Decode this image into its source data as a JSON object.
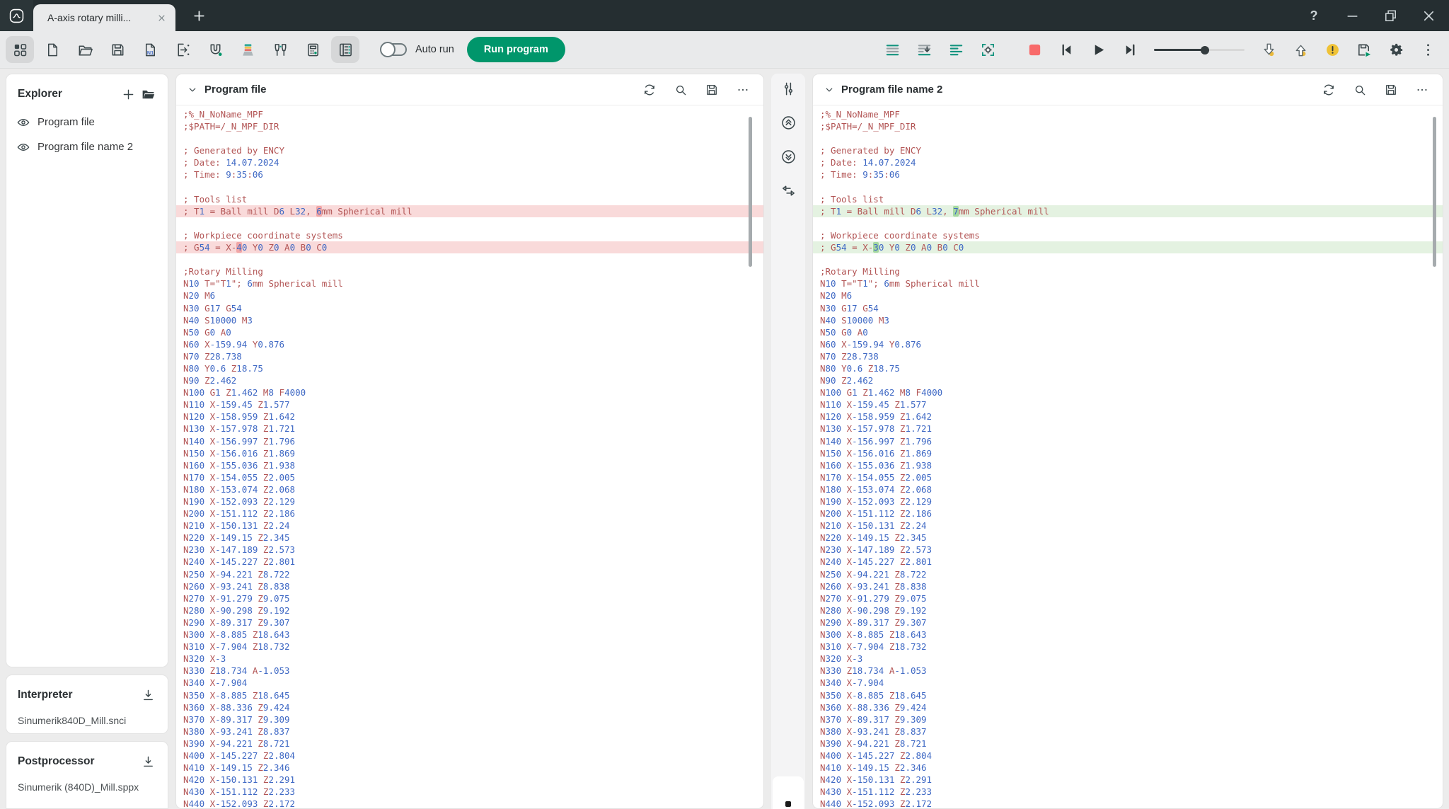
{
  "window": {
    "tab_title": "A-axis rotary milli...",
    "help_label": "?",
    "controls": [
      {
        "name": "help-button",
        "icon": "help"
      },
      {
        "name": "minimize-button",
        "icon": "minimize-icon"
      },
      {
        "name": "maximize-button",
        "icon": "maximize-icon"
      },
      {
        "name": "close-button",
        "icon": "close-icon"
      }
    ]
  },
  "toolbar": {
    "left_icons": [
      {
        "name": "home-grid-icon",
        "active": true
      },
      {
        "name": "new-file-icon"
      },
      {
        "name": "open-folder-icon"
      },
      {
        "name": "save-icon"
      },
      {
        "name": "renumber-icon"
      },
      {
        "name": "insert-file-icon"
      },
      {
        "name": "magnet-icon"
      },
      {
        "name": "layers-icon"
      },
      {
        "name": "tools-icon"
      },
      {
        "name": "calculator-icon"
      },
      {
        "name": "editor-view-icon",
        "active": true
      }
    ],
    "auto_run_label": "Auto run",
    "auto_run_on": false,
    "run_button_label": "Run program",
    "view_icons": [
      {
        "name": "structure-lines-icon"
      },
      {
        "name": "goto-line-icon"
      },
      {
        "name": "format-lines-icon"
      },
      {
        "name": "gear-frame-icon"
      }
    ],
    "playback_icons": [
      {
        "name": "stop-icon"
      },
      {
        "name": "skip-start-icon"
      },
      {
        "name": "play-icon"
      },
      {
        "name": "skip-end-icon"
      }
    ],
    "slider_value_pct": 56,
    "tail_icons": [
      {
        "name": "sim-down-icon"
      },
      {
        "name": "sim-up-icon"
      },
      {
        "name": "warning-icon"
      },
      {
        "name": "post-save-icon"
      },
      {
        "name": "settings-gear-icon"
      },
      {
        "name": "kebab-menu-icon"
      }
    ]
  },
  "explorer": {
    "title": "Explorer",
    "header_icons": [
      {
        "name": "plus-icon"
      },
      {
        "name": "folder-filled-icon"
      }
    ],
    "item_icon": "eye-icon",
    "items": [
      {
        "label": "Program file"
      },
      {
        "label": "Program file name 2"
      }
    ]
  },
  "interpreter": {
    "title": "Interpreter",
    "action_icon": "download-icon",
    "value": "Sinumerik840D_Mill.snci"
  },
  "postprocessor": {
    "title": "Postprocessor",
    "action_icon": "download-icon",
    "value": "Sinumerik (840D)_Mill.sppx"
  },
  "divider": {
    "icons": [
      {
        "name": "tune-icon"
      },
      {
        "name": "collapse-up-icon"
      },
      {
        "name": "collapse-down-icon"
      },
      {
        "name": "swap-icon"
      }
    ]
  },
  "panels_common": {
    "header_icons": [
      {
        "name": "sync-icon"
      },
      {
        "name": "search-icon"
      },
      {
        "name": "save-icon"
      },
      {
        "name": "more-icon"
      }
    ]
  },
  "code_colors": {
    "letters": "#B25454",
    "numbers": "#3E68C4",
    "removed_bg": "#F9DADA",
    "removed_mark": "#F1A6A6",
    "added_bg": "#E4F2E1",
    "added_mark": "#A5D8A0",
    "accent_green": "#00966B",
    "stop_red": "#F86A6A"
  },
  "panels": [
    {
      "title": "Program file",
      "diff_mode": "removed",
      "lines": [
        {
          "t": ";%_N_NoName_MPF"
        },
        {
          "t": ";$PATH=/_N_MPF_DIR"
        },
        {
          "t": ""
        },
        {
          "t": "; Generated by ENCY"
        },
        {
          "t": "; Date: 14.07.2024"
        },
        {
          "t": "; Time: 9:35:06"
        },
        {
          "t": ""
        },
        {
          "t": "; Tools list"
        },
        {
          "t": "; T1 = Ball mill D6 L32, «6»mm Spherical mill",
          "d": true
        },
        {
          "t": ""
        },
        {
          "t": "; Workpiece coordinate systems"
        },
        {
          "t": "; G54 = X-«4»0 Y0 Z0 A0 B0 C0",
          "d": true
        },
        {
          "t": ""
        },
        {
          "t": ";Rotary Milling"
        },
        {
          "t": "N10 T=\"T1\"; 6mm Spherical mill"
        },
        {
          "t": "N20 M6"
        },
        {
          "t": "N30 G17 G54"
        },
        {
          "t": "N40 S10000 M3"
        },
        {
          "t": "N50 G0 A0"
        },
        {
          "t": "N60 X-159.94 Y0.876"
        },
        {
          "t": "N70 Z28.738"
        },
        {
          "t": "N80 Y0.6 Z18.75"
        },
        {
          "t": "N90 Z2.462"
        },
        {
          "t": "N100 G1 Z1.462 M8 F4000"
        },
        {
          "t": "N110 X-159.45 Z1.577"
        },
        {
          "t": "N120 X-158.959 Z1.642"
        },
        {
          "t": "N130 X-157.978 Z1.721"
        },
        {
          "t": "N140 X-156.997 Z1.796"
        },
        {
          "t": "N150 X-156.016 Z1.869"
        },
        {
          "t": "N160 X-155.036 Z1.938"
        },
        {
          "t": "N170 X-154.055 Z2.005"
        },
        {
          "t": "N180 X-153.074 Z2.068"
        },
        {
          "t": "N190 X-152.093 Z2.129"
        },
        {
          "t": "N200 X-151.112 Z2.186"
        },
        {
          "t": "N210 X-150.131 Z2.24"
        },
        {
          "t": "N220 X-149.15 Z2.345"
        },
        {
          "t": "N230 X-147.189 Z2.573"
        },
        {
          "t": "N240 X-145.227 Z2.801"
        },
        {
          "t": "N250 X-94.221 Z8.722"
        },
        {
          "t": "N260 X-93.241 Z8.838"
        },
        {
          "t": "N270 X-91.279 Z9.075"
        },
        {
          "t": "N280 X-90.298 Z9.192"
        },
        {
          "t": "N290 X-89.317 Z9.307"
        },
        {
          "t": "N300 X-8.885 Z18.643"
        },
        {
          "t": "N310 X-7.904 Z18.732"
        },
        {
          "t": "N320 X-3"
        },
        {
          "t": "N330 Z18.734 A-1.053"
        },
        {
          "t": "N340 X-7.904"
        },
        {
          "t": "N350 X-8.885 Z18.645"
        },
        {
          "t": "N360 X-88.336 Z9.424"
        },
        {
          "t": "N370 X-89.317 Z9.309"
        },
        {
          "t": "N380 X-93.241 Z8.837"
        },
        {
          "t": "N390 X-94.221 Z8.721"
        },
        {
          "t": "N400 X-145.227 Z2.804"
        },
        {
          "t": "N410 X-149.15 Z2.346"
        },
        {
          "t": "N420 X-150.131 Z2.291"
        },
        {
          "t": "N430 X-151.112 Z2.233"
        },
        {
          "t": "N440 X-152.093 Z2.172"
        }
      ]
    },
    {
      "title": "Program file name 2",
      "diff_mode": "added",
      "lines": [
        {
          "t": ";%_N_NoName_MPF"
        },
        {
          "t": ";$PATH=/_N_MPF_DIR"
        },
        {
          "t": ""
        },
        {
          "t": "; Generated by ENCY"
        },
        {
          "t": "; Date: 14.07.2024"
        },
        {
          "t": "; Time: 9:35:06"
        },
        {
          "t": ""
        },
        {
          "t": "; Tools list"
        },
        {
          "t": "; T1 = Ball mill D6 L32, «7»mm Spherical mill",
          "d": true
        },
        {
          "t": ""
        },
        {
          "t": "; Workpiece coordinate systems"
        },
        {
          "t": "; G54 = X-«3»0 Y0 Z0 A0 B0 C0",
          "d": true
        },
        {
          "t": ""
        },
        {
          "t": ";Rotary Milling"
        },
        {
          "t": "N10 T=\"T1\"; 6mm Spherical mill"
        },
        {
          "t": "N20 M6"
        },
        {
          "t": "N30 G17 G54"
        },
        {
          "t": "N40 S10000 M3"
        },
        {
          "t": "N50 G0 A0"
        },
        {
          "t": "N60 X-159.94 Y0.876"
        },
        {
          "t": "N70 Z28.738"
        },
        {
          "t": "N80 Y0.6 Z18.75"
        },
        {
          "t": "N90 Z2.462"
        },
        {
          "t": "N100 G1 Z1.462 M8 F4000"
        },
        {
          "t": "N110 X-159.45 Z1.577"
        },
        {
          "t": "N120 X-158.959 Z1.642"
        },
        {
          "t": "N130 X-157.978 Z1.721"
        },
        {
          "t": "N140 X-156.997 Z1.796"
        },
        {
          "t": "N150 X-156.016 Z1.869"
        },
        {
          "t": "N160 X-155.036 Z1.938"
        },
        {
          "t": "N170 X-154.055 Z2.005"
        },
        {
          "t": "N180 X-153.074 Z2.068"
        },
        {
          "t": "N190 X-152.093 Z2.129"
        },
        {
          "t": "N200 X-151.112 Z2.186"
        },
        {
          "t": "N210 X-150.131 Z2.24"
        },
        {
          "t": "N220 X-149.15 Z2.345"
        },
        {
          "t": "N230 X-147.189 Z2.573"
        },
        {
          "t": "N240 X-145.227 Z2.801"
        },
        {
          "t": "N250 X-94.221 Z8.722"
        },
        {
          "t": "N260 X-93.241 Z8.838"
        },
        {
          "t": "N270 X-91.279 Z9.075"
        },
        {
          "t": "N280 X-90.298 Z9.192"
        },
        {
          "t": "N290 X-89.317 Z9.307"
        },
        {
          "t": "N300 X-8.885 Z18.643"
        },
        {
          "t": "N310 X-7.904 Z18.732"
        },
        {
          "t": "N320 X-3"
        },
        {
          "t": "N330 Z18.734 A-1.053"
        },
        {
          "t": "N340 X-7.904"
        },
        {
          "t": "N350 X-8.885 Z18.645"
        },
        {
          "t": "N360 X-88.336 Z9.424"
        },
        {
          "t": "N370 X-89.317 Z9.309"
        },
        {
          "t": "N380 X-93.241 Z8.837"
        },
        {
          "t": "N390 X-94.221 Z8.721"
        },
        {
          "t": "N400 X-145.227 Z2.804"
        },
        {
          "t": "N410 X-149.15 Z2.346"
        },
        {
          "t": "N420 X-150.131 Z2.291"
        },
        {
          "t": "N430 X-151.112 Z2.233"
        },
        {
          "t": "N440 X-152.093 Z2.172"
        }
      ]
    }
  ]
}
